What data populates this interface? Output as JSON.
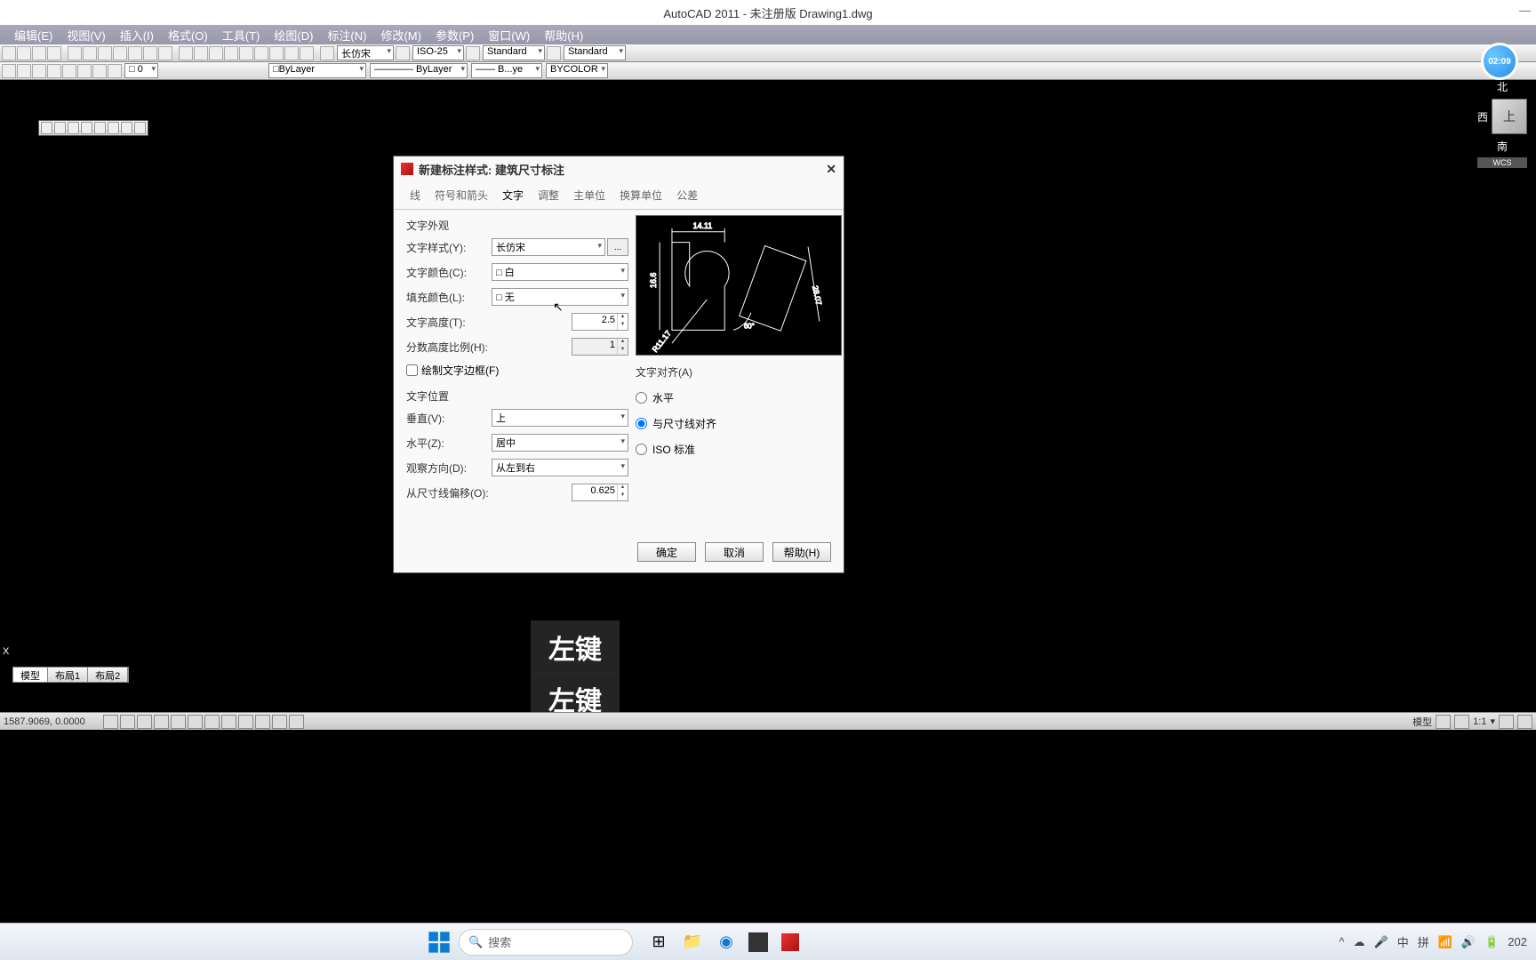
{
  "titlebar": {
    "text": "AutoCAD 2011 - 未注册版     Drawing1.dwg"
  },
  "menubar": [
    "编辑(E)",
    "视图(V)",
    "插入(I)",
    "格式(O)",
    "工具(T)",
    "绘图(D)",
    "标注(N)",
    "修改(M)",
    "参数(P)",
    "窗口(W)",
    "帮助(H)"
  ],
  "toolbar1": {
    "dim_style": "长仿宋",
    "iso": "ISO-25",
    "std1": "Standard",
    "std2": "Standard"
  },
  "toolbar2": {
    "layer": "□ByLayer",
    "linetype": "———— ByLayer",
    "lineweight": "—— B...ye",
    "color": "BYCOLOR",
    "coord": "□ 0"
  },
  "navcube": {
    "n": "北",
    "s": "南",
    "w": "西",
    "top": "上",
    "wcs": "WCS"
  },
  "clock": "02:09",
  "dialog": {
    "title": "新建标注样式: 建筑尺寸标注",
    "tabs": [
      "线",
      "符号和箭头",
      "文字",
      "调整",
      "主单位",
      "换算单位",
      "公差"
    ],
    "active_tab": 2,
    "appearance": {
      "grp": "文字外观",
      "style_lbl": "文字样式(Y):",
      "style_val": "长仿宋",
      "color_lbl": "文字颜色(C):",
      "color_val": "白",
      "fill_lbl": "填充颜色(L):",
      "fill_val": "无",
      "height_lbl": "文字高度(T):",
      "height_val": "2.5",
      "scale_lbl": "分数高度比例(H):",
      "scale_val": "1",
      "frame_lbl": "绘制文字边框(F)"
    },
    "placement": {
      "grp": "文字位置",
      "vert_lbl": "垂直(V):",
      "vert_val": "上",
      "horiz_lbl": "水平(Z):",
      "horiz_val": "居中",
      "dir_lbl": "观察方向(D):",
      "dir_val": "从左到右",
      "offset_lbl": "从尺寸线偏移(O):",
      "offset_val": "0.625"
    },
    "align": {
      "grp": "文字对齐(A)",
      "r1": "水平",
      "r2": "与尺寸线对齐",
      "r3": "ISO 标准",
      "selected": 1
    },
    "preview": {
      "dim1": "14.11",
      "dim2": "16.6",
      "dim3": "28.07",
      "dim4": "R11.17",
      "dim5": "60°"
    },
    "btns": {
      "ok": "确定",
      "cancel": "取消",
      "help": "帮助(H)"
    }
  },
  "key_overlay": "左键",
  "layout_tabs": [
    "模型",
    "布局1",
    "布局2"
  ],
  "statusbar": {
    "coords": "1587.9069, 0.0000",
    "right_items": [
      "模型",
      "1:1",
      "▾"
    ]
  },
  "taskbar": {
    "search": "搜索",
    "tray": {
      "ime1": "中",
      "ime2": "拼",
      "time": "202"
    }
  }
}
